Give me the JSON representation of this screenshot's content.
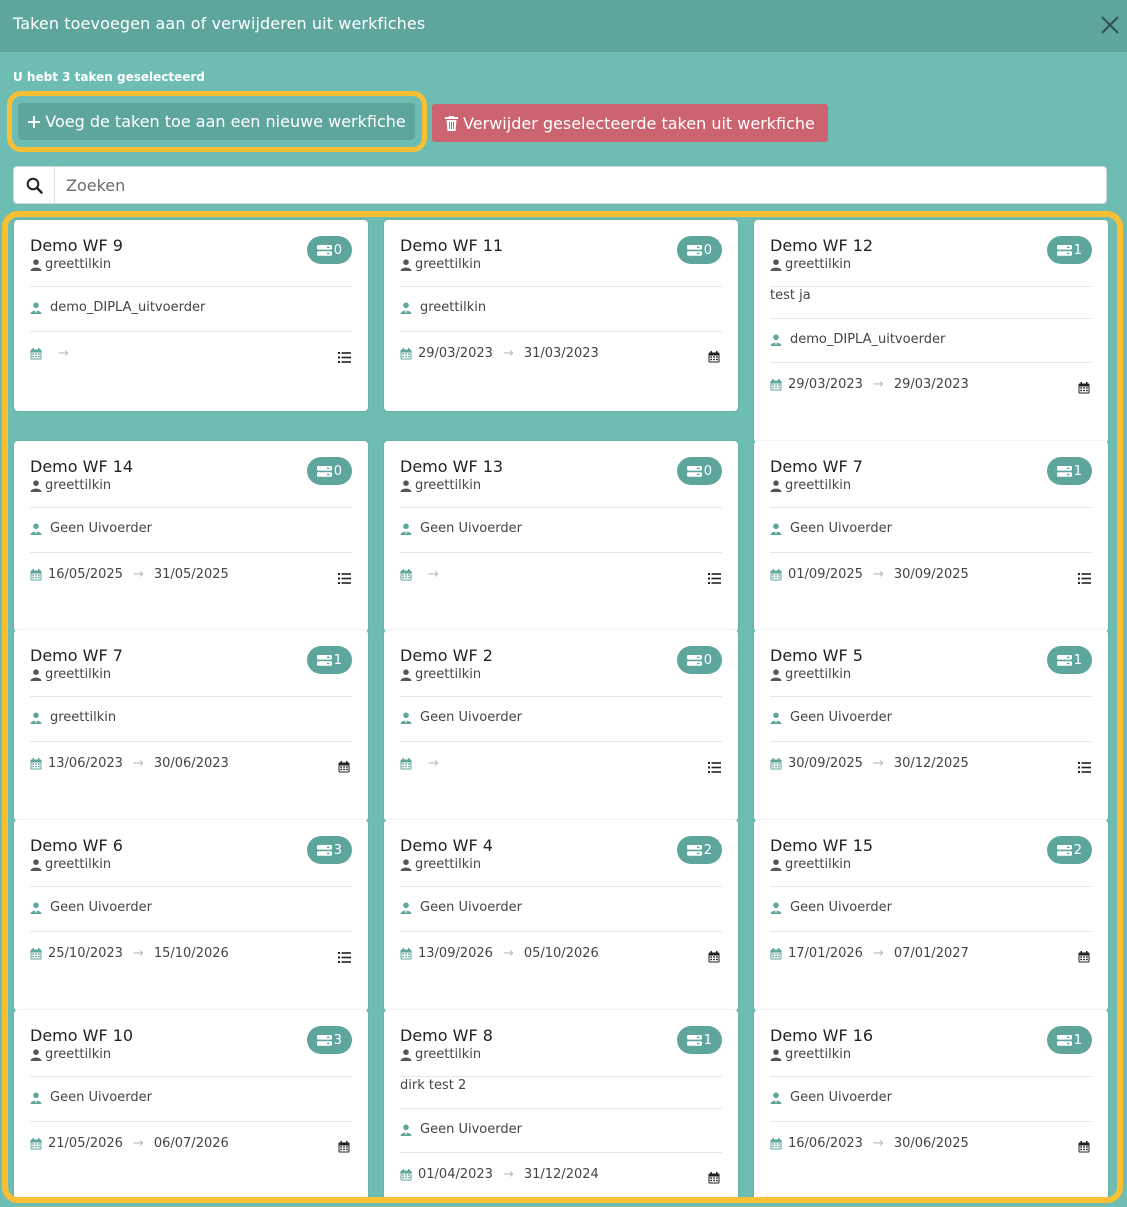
{
  "dialog": {
    "title": "Taken toevoegen aan of verwijderen uit werkfiches",
    "close_icon": "close-icon",
    "selected_info": "U hebt 3 taken geselecteerd",
    "add_button_label": "Voeg de taken toe aan een nieuwe werkfiche",
    "remove_button_label": "Verwijder geselecteerde taken uit werkfiche"
  },
  "search": {
    "placeholder": "Zoeken",
    "value": ""
  },
  "colors": {
    "teal": "#5ea69c",
    "background": "#6dbdb3",
    "danger": "#cc6470",
    "highlight": "#fbbf33"
  },
  "cards": [
    {
      "title": "Demo WF 9",
      "owner": "greettilkin",
      "count": "0",
      "description": "",
      "executor": "demo_DIPLA_uitvoerder",
      "start": "",
      "end": "",
      "view": "list"
    },
    {
      "title": "Demo WF 11",
      "owner": "greettilkin",
      "count": "0",
      "description": "",
      "executor": "greettilkin",
      "start": "29/03/2023",
      "end": "31/03/2023",
      "view": "calendar"
    },
    {
      "title": "Demo WF 12",
      "owner": "greettilkin",
      "count": "1",
      "description": "test ja",
      "executor": "demo_DIPLA_uitvoerder",
      "start": "29/03/2023",
      "end": "29/03/2023",
      "view": "calendar"
    },
    {
      "title": "Demo WF 14",
      "owner": "greettilkin",
      "count": "0",
      "description": "",
      "executor": "Geen Uivoerder",
      "start": "16/05/2025",
      "end": "31/05/2025",
      "view": "list"
    },
    {
      "title": "Demo WF 13",
      "owner": "greettilkin",
      "count": "0",
      "description": "",
      "executor": "Geen Uivoerder",
      "start": "",
      "end": "",
      "view": "list"
    },
    {
      "title": "Demo WF 7",
      "owner": "greettilkin",
      "count": "1",
      "description": "",
      "executor": "Geen Uivoerder",
      "start": "01/09/2025",
      "end": "30/09/2025",
      "view": "list"
    },
    {
      "title": "Demo WF 7",
      "owner": "greettilkin",
      "count": "1",
      "description": "",
      "executor": "greettilkin",
      "start": "13/06/2023",
      "end": "30/06/2023",
      "view": "calendar"
    },
    {
      "title": "Demo WF 2",
      "owner": "greettilkin",
      "count": "0",
      "description": "",
      "executor": "Geen Uivoerder",
      "start": "",
      "end": "",
      "view": "list"
    },
    {
      "title": "Demo WF 5",
      "owner": "greettilkin",
      "count": "1",
      "description": "",
      "executor": "Geen Uivoerder",
      "start": "30/09/2025",
      "end": "30/12/2025",
      "view": "list"
    },
    {
      "title": "Demo WF 6",
      "owner": "greettilkin",
      "count": "3",
      "description": "",
      "executor": "Geen Uivoerder",
      "start": "25/10/2023",
      "end": "15/10/2026",
      "view": "list"
    },
    {
      "title": "Demo WF 4",
      "owner": "greettilkin",
      "count": "2",
      "description": "",
      "executor": "Geen Uivoerder",
      "start": "13/09/2026",
      "end": "05/10/2026",
      "view": "calendar"
    },
    {
      "title": "Demo WF 15",
      "owner": "greettilkin",
      "count": "2",
      "description": "",
      "executor": "Geen Uivoerder",
      "start": "17/01/2026",
      "end": "07/01/2027",
      "view": "calendar"
    },
    {
      "title": "Demo WF 10",
      "owner": "greettilkin",
      "count": "3",
      "description": "",
      "executor": "Geen Uivoerder",
      "start": "21/05/2026",
      "end": "06/07/2026",
      "view": "calendar"
    },
    {
      "title": "Demo WF 8",
      "owner": "greettilkin",
      "count": "1",
      "description": "dirk test 2",
      "executor": "Geen Uivoerder",
      "start": "01/04/2023",
      "end": "31/12/2024",
      "view": "calendar"
    },
    {
      "title": "Demo WF 16",
      "owner": "greettilkin",
      "count": "1",
      "description": "",
      "executor": "Geen Uivoerder",
      "start": "16/06/2023",
      "end": "30/06/2025",
      "view": "calendar"
    }
  ]
}
